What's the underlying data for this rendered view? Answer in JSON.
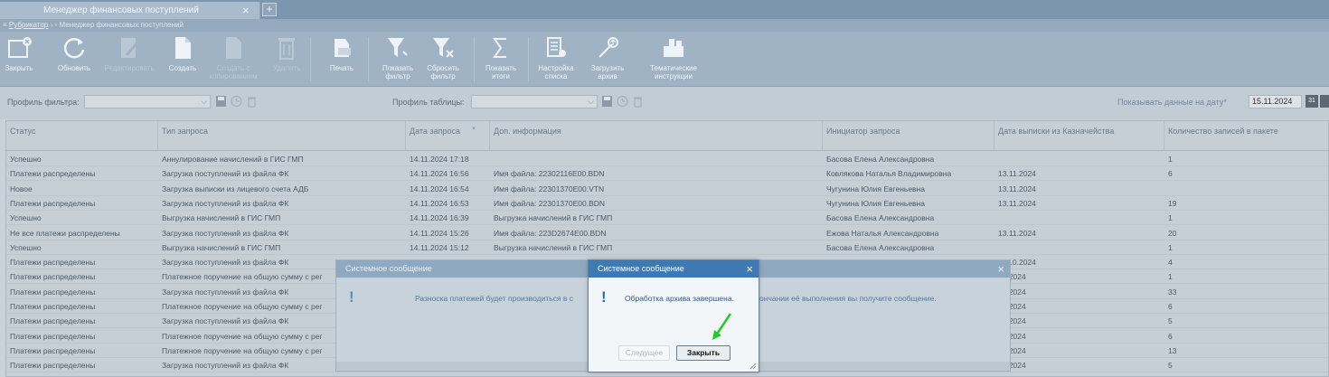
{
  "tab": {
    "title": "Менеджер финансовых поступлений",
    "close": "×",
    "add": "+"
  },
  "breadcrumb": {
    "root": "Рубрикатор",
    "sep": "›",
    "current": "Менеджер финансовых поступлений"
  },
  "toolbar": {
    "close": "Закрыть",
    "refresh": "Обновить",
    "edit": "Редактировать",
    "create": "Создать",
    "create_on_basis": "Создать с копированием",
    "delete": "Удалить",
    "print": "Печать",
    "show_filter": "Показать фильтр",
    "reset_filter": "Сбросить фильтр",
    "show_totals": "Показать итоги",
    "list_settings": "Настройка списка",
    "load_archive": "Загрузить архив",
    "instructions": "Тематические инструкции"
  },
  "filters": {
    "filter_profile_label": "Профиль фильтра:",
    "table_profile_label": "Профиль таблицы:",
    "date_label": "Показывать данные на дату",
    "date_required": "*",
    "date_value": "15.11.2024",
    "calendar_icon": "31"
  },
  "grid": {
    "columns": [
      "Статус",
      "Тип запроса",
      "Дата запроса",
      "Доп. информация",
      "Инициатор запроса",
      "Дата выписки из Казначейства",
      "Количество записей в пакете"
    ],
    "rows": [
      [
        "Успешно",
        "Аннулирование начислений в ГИС ГМП",
        "14.11.2024 17:18",
        "",
        "Басова Елена Александровна",
        "",
        "1"
      ],
      [
        "Платежи распределены",
        "Загрузка поступлений из файла ФК",
        "14.11.2024 16:56",
        "Имя файла: 22302116E00.BDN",
        "Ковлякова Наталья Владимировна",
        "13.11.2024",
        "6"
      ],
      [
        "Новое",
        "Загрузка выписки из лицевого счета АДБ",
        "14.11.2024 16:54",
        "Имя файла: 22301370E00.VTN",
        "Чугунина Юлия Евгеньевна",
        "13.11.2024",
        ""
      ],
      [
        "Платежи распределены",
        "Загрузка поступлений из файла ФК",
        "14.11.2024 16:53",
        "Имя файла: 22301370E00.BDN",
        "Чугунина Юлия Евгеньевна",
        "13.11.2024",
        "19"
      ],
      [
        "Успешно",
        "Выгрузка начислений в ГИС ГМП",
        "14.11.2024 16:39",
        "Выгрузка начислений в ГИС ГМП",
        "Басова Елена Александровна",
        "",
        "1"
      ],
      [
        "Не все платежи распределены",
        "Загрузка поступлений из файла ФК",
        "14.11.2024 15:26",
        "Имя файла: 223D2674E00.BDN",
        "Ежова Наталья Александровна",
        "13.11.2024",
        "20"
      ],
      [
        "Успешно",
        "Выгрузка начислений в ГИС ГМП",
        "14.11.2024 15:12",
        "Выгрузка начислений в ГИС ГМП",
        "Басова Елена Александровна",
        "",
        "1"
      ],
      [
        "Платежи распределены",
        "Загрузка поступлений из файла ФК",
        "",
        "",
        "",
        "11.10.2024",
        "4"
      ],
      [
        "Платежи распределены",
        "Платежное поручение на общую сумму с рег",
        "",
        "",
        "",
        "10.2024",
        "1"
      ],
      [
        "Платежи распределены",
        "Загрузка поступлений из файла ФК",
        "",
        "",
        "",
        "10.2024",
        "33"
      ],
      [
        "Платежи распределены",
        "Платежное поручение на общую сумму с рег",
        "",
        "",
        "",
        "10.2024",
        "6"
      ],
      [
        "Платежи распределены",
        "Загрузка поступлений из файла ФК",
        "",
        "",
        "",
        "10.2024",
        "5"
      ],
      [
        "Платежи распределены",
        "Платежное поручение на общую сумму с рег",
        "",
        "",
        "",
        "10.2024",
        "6"
      ],
      [
        "Платежи распределены",
        "Платежное поручение на общую сумму с рег",
        "",
        "",
        "",
        "10.2024",
        "13"
      ],
      [
        "Платежи распределены",
        "Загрузка поступлений из файла ФК",
        "",
        "",
        "",
        "10.2024",
        "5"
      ]
    ]
  },
  "back_dialog": {
    "title": "Системное сообщение",
    "close": "×",
    "icon": "!",
    "message_left": "Разноска платежей будет производиться в с",
    "message_right": "ончании её выполнения вы получите сообщение."
  },
  "front_dialog": {
    "title": "Системное сообщение",
    "close": "×",
    "icon": "!",
    "message": "Обработка архива завершена.",
    "next_label": "Следущее",
    "close_label": "Закрыть"
  },
  "colors": {
    "accent": "#3e79b2",
    "annotation_arrow": "#22cc22"
  }
}
